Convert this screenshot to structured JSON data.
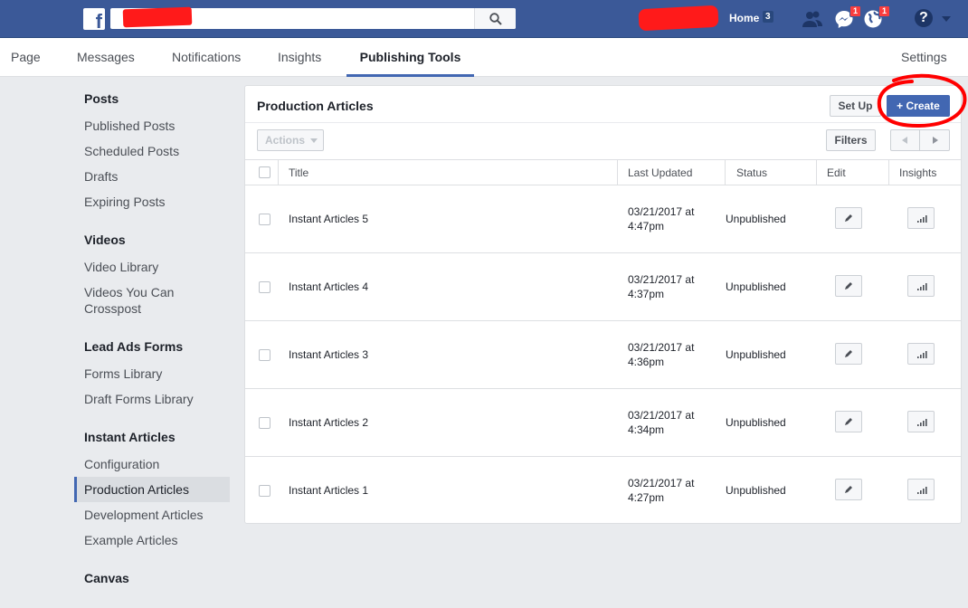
{
  "topbar": {
    "logo_letter": "f",
    "home_label": "Home",
    "home_count": "3",
    "messages_badge": "1",
    "notifications_badge": "1",
    "help_glyph": "?"
  },
  "page_nav": {
    "tabs": [
      "Page",
      "Messages",
      "Notifications",
      "Insights",
      "Publishing Tools"
    ],
    "active_tab": "Publishing Tools",
    "settings_label": "Settings"
  },
  "sidebar": {
    "sections": [
      {
        "heading": "Posts",
        "items": [
          "Published Posts",
          "Scheduled Posts",
          "Drafts",
          "Expiring Posts"
        ]
      },
      {
        "heading": "Videos",
        "items": [
          "Video Library",
          "Videos You Can Crosspost"
        ]
      },
      {
        "heading": "Lead Ads Forms",
        "items": [
          "Forms Library",
          "Draft Forms Library"
        ]
      },
      {
        "heading": "Instant Articles",
        "items": [
          "Configuration",
          "Production Articles",
          "Development Articles",
          "Example Articles"
        ]
      },
      {
        "heading": "Canvas",
        "items": []
      }
    ],
    "active_item": "Production Articles"
  },
  "main": {
    "title": "Production Articles",
    "setup_label": "Set Up",
    "create_label": "+ Create",
    "actions_label": "Actions",
    "filters_label": "Filters",
    "columns": [
      "Title",
      "Last Updated",
      "Status",
      "Edit",
      "Insights"
    ],
    "rows": [
      {
        "title": "Instant Articles 5",
        "updated_line1": "03/21/2017 at",
        "updated_line2": "4:47pm",
        "status": "Unpublished"
      },
      {
        "title": "Instant Articles 4",
        "updated_line1": "03/21/2017 at",
        "updated_line2": "4:37pm",
        "status": "Unpublished"
      },
      {
        "title": "Instant Articles 3",
        "updated_line1": "03/21/2017 at",
        "updated_line2": "4:36pm",
        "status": "Unpublished"
      },
      {
        "title": "Instant Articles 2",
        "updated_line1": "03/21/2017 at",
        "updated_line2": "4:34pm",
        "status": "Unpublished"
      },
      {
        "title": "Instant Articles 1",
        "updated_line1": "03/21/2017 at",
        "updated_line2": "4:27pm",
        "status": "Unpublished"
      }
    ]
  },
  "colors": {
    "brand": "#3b5998",
    "accent": "#4267b2",
    "annotation": "#ff0000",
    "redaction": "#ff1a1a"
  }
}
